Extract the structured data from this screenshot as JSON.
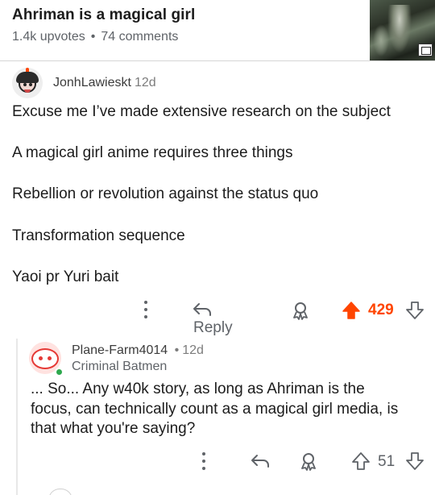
{
  "post": {
    "title": "Ahriman is a magical girl",
    "upvotes": "1.4k upvotes",
    "separator": "•",
    "comments": "74 comments"
  },
  "comment1": {
    "username": "JonhLawieskt",
    "age": "12d",
    "lines": [
      "Excuse me I’ve made extensive research on the subject",
      "A magical girl anime requires three things",
      "Rebellion or revolution against the status quo",
      "Transformation sequence",
      "Yaoi pr Yuri bait"
    ],
    "reply_label": "Reply",
    "score": "429",
    "vote_state": "upvoted"
  },
  "comment2": {
    "username": "Plane-Farm4014",
    "separator": "•",
    "age": "12d",
    "flair": "Criminal Batmen",
    "lines": [
      "... So... Any w40k story, as long as Ahriman is the",
      "focus, can technically count as a magical girl media, is",
      "that what you're saying?"
    ],
    "score": "51",
    "online": true
  },
  "colors": {
    "upvote_active": "#ff4500",
    "online_indicator": "#2ea84e",
    "text_muted": "#5f6368"
  },
  "icons": [
    "kebab-icon",
    "reply-arrow-icon",
    "award-icon",
    "upvote-icon",
    "downvote-icon",
    "image-icon"
  ]
}
